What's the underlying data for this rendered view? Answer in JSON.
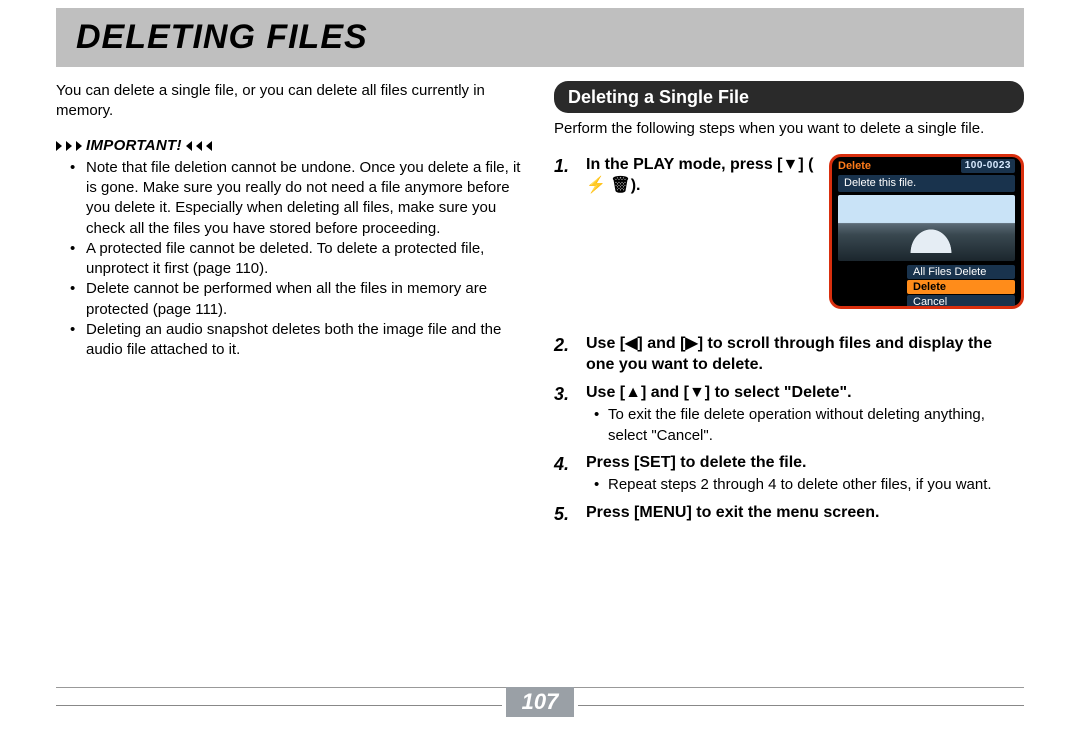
{
  "page": {
    "title": "DELETING FILES",
    "number": "107"
  },
  "left": {
    "intro": "You can delete a single file, or you can delete all files currently in memory.",
    "important_label": "IMPORTANT!",
    "bullets": [
      "Note that file deletion cannot be undone. Once you delete a file, it is gone. Make sure you really do not need a file anymore before you delete it. Especially when deleting all files, make sure you check all the files you have stored before proceeding.",
      "A protected file cannot be deleted. To delete a protected file, unprotect it first (page 110).",
      "Delete cannot be performed when all the files in memory are protected (page 111).",
      "Deleting an audio snapshot deletes both the image file and the audio file attached to it."
    ]
  },
  "right": {
    "section_head": "Deleting a Single File",
    "intro": "Perform the following steps when you want to delete a single file.",
    "steps": [
      {
        "n": "1.",
        "title_a": "In the PLAY mode, press [",
        "title_b": "] (",
        "title_c": ").",
        "sub": []
      },
      {
        "n": "2.",
        "title": "Use [◀] and [▶] to scroll through files and display the one you want to delete.",
        "sub": []
      },
      {
        "n": "3.",
        "title": "Use [▲] and [▼] to select \"Delete\".",
        "sub": [
          "To exit the file delete operation without deleting anything, select \"Cancel\"."
        ]
      },
      {
        "n": "4.",
        "title": "Press [SET] to delete the file.",
        "sub": [
          "Repeat steps 2 through 4 to delete other files, if you want."
        ]
      },
      {
        "n": "5.",
        "title": "Press [MENU] to exit the menu screen.",
        "sub": []
      }
    ],
    "screen": {
      "top_label": "Delete",
      "file_number": "100-0023",
      "prompt": "Delete this file.",
      "menu": [
        "All Files Delete",
        "Delete",
        "Cancel"
      ],
      "selected_index": 1
    }
  },
  "glyphs": {
    "down": "▼",
    "flash": "⚡",
    "trash": "🗑"
  }
}
